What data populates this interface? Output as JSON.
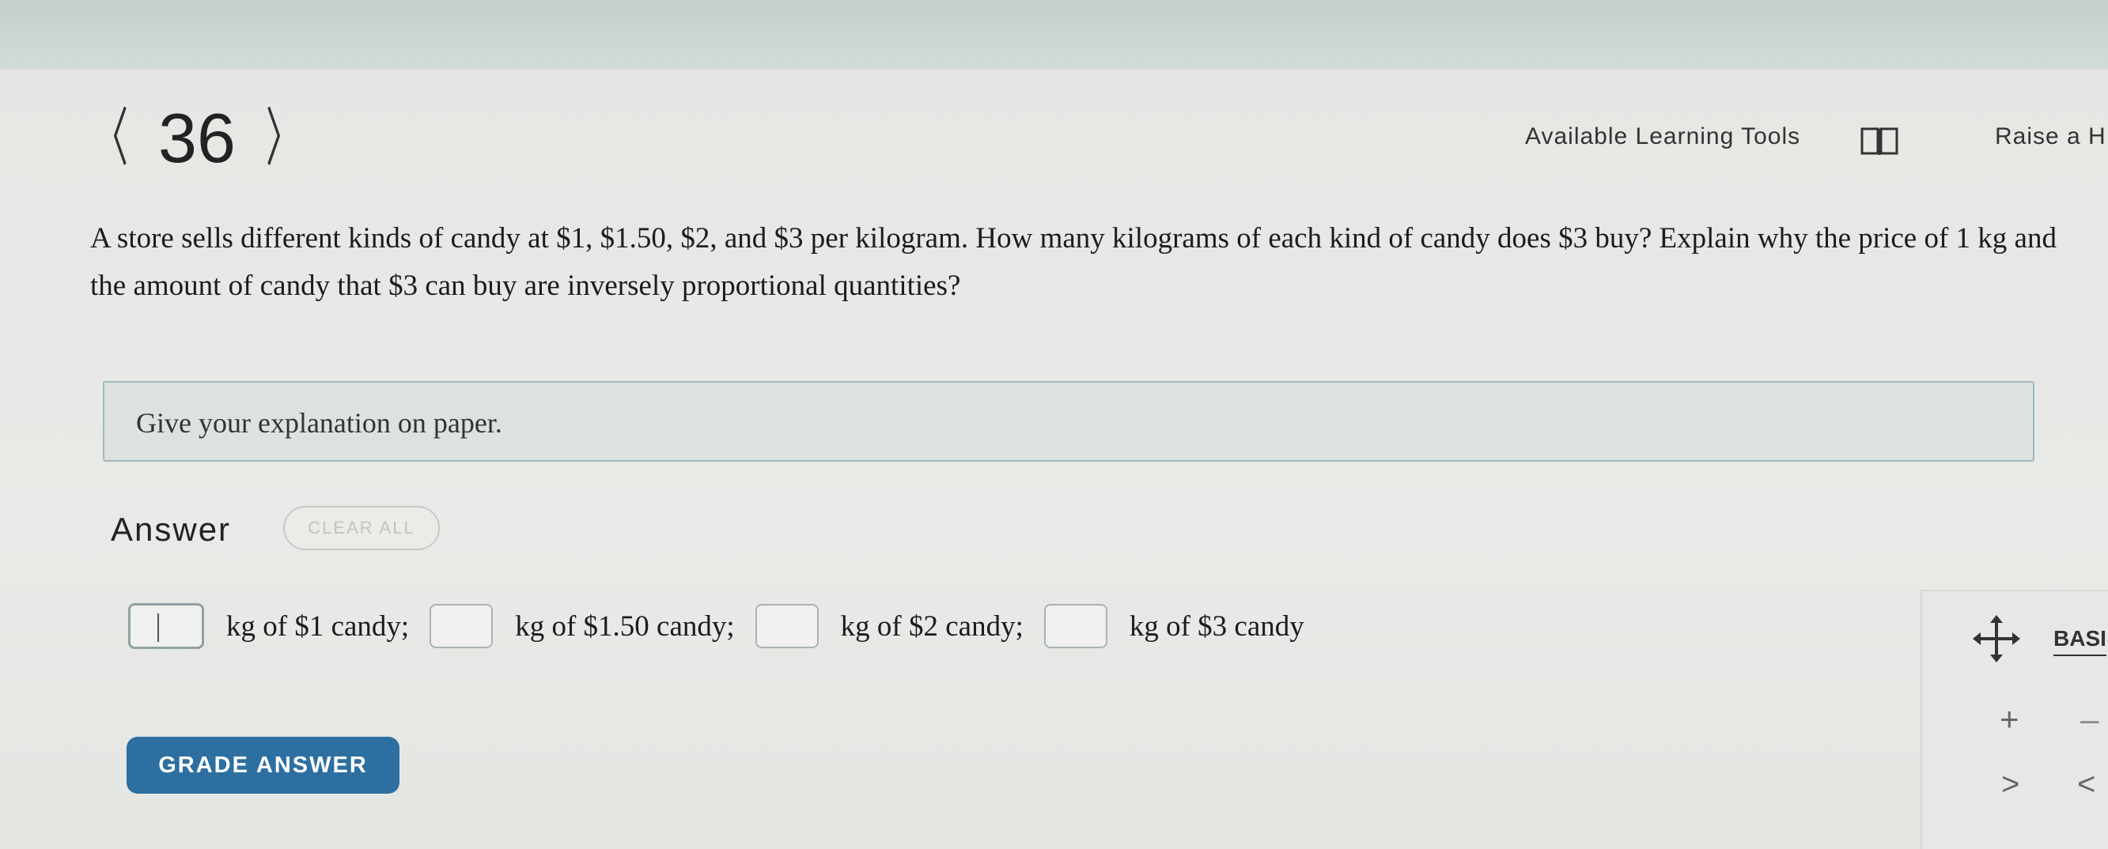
{
  "header": {
    "question_number": "36",
    "prev_arrow": "〈",
    "next_arrow": "〉",
    "learning_tools_label": "Available Learning Tools",
    "raise_hand_label": "Raise a H"
  },
  "question": {
    "text": "A store sells different kinds of candy at $1, $1.50, $2, and $3 per kilogram. How many kilograms of each kind of candy does $3 buy? Explain why the price of 1 kg and the amount of candy that $3 can buy are inversely proportional quantities?"
  },
  "explanation": {
    "text": "Give your explanation on paper."
  },
  "answer": {
    "label": "Answer",
    "clear_all_label": "CLEAR ALL",
    "segments": [
      {
        "value": "",
        "label": "kg of $1 candy;"
      },
      {
        "value": "",
        "label": "kg of $1.50 candy;"
      },
      {
        "value": "",
        "label": "kg of $2 candy;"
      },
      {
        "value": "",
        "label": "kg of $3 candy"
      }
    ],
    "grade_button_label": "GRADE ANSWER"
  },
  "tool_panel": {
    "move_icon": "move-arrows-icon",
    "tab_label": "BASI",
    "plus_key": "+",
    "minus_key": "–",
    "greater_key": ">",
    "less_key": "<"
  }
}
